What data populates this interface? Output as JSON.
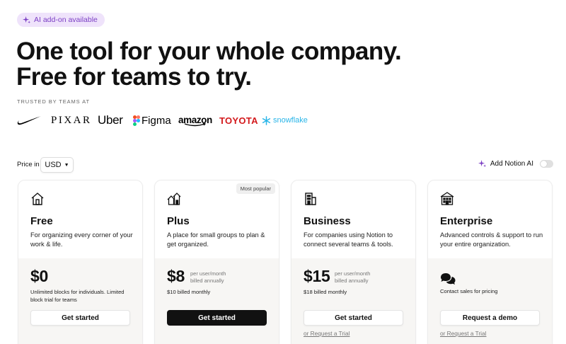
{
  "badge": {
    "label": "AI add-on available",
    "icon": "sparkle-icon",
    "color": "#7b3fc4"
  },
  "headline": {
    "line1": "One tool for your whole company.",
    "line2": "Free for teams to try."
  },
  "trusted": {
    "label": "TRUSTED BY TEAMS AT"
  },
  "logos": {
    "nike": "nike-swoosh-logo",
    "pixar": "PIXAR",
    "uber": "Uber",
    "figma": "Figma",
    "amazon": "amazon",
    "toyota": "TOYOTA",
    "snowflake": "snowflake"
  },
  "pricing_controls": {
    "price_in_label": "Price in",
    "currency_value": "USD",
    "ai_toggle_label": "Add Notion AI",
    "ai_toggle_on": false
  },
  "plans": [
    {
      "name": "Free",
      "description": "For organizing every corner of your work & life.",
      "price": "$0",
      "price_note": "",
      "billing": "Unlimited blocks for individuals. Limited block trial for teams",
      "button": "Get started",
      "trial_link": "",
      "badge": ""
    },
    {
      "name": "Plus",
      "description": "A place for small groups to plan & get organized.",
      "price": "$8",
      "price_note_1": "per user/month",
      "price_note_2": "billed annually",
      "billing": "$10 billed monthly",
      "button": "Get started",
      "trial_link": "",
      "badge": "Most popular"
    },
    {
      "name": "Business",
      "description": "For companies using Notion to connect several teams & tools.",
      "price": "$15",
      "price_note_1": "per user/month",
      "price_note_2": "billed annually",
      "billing": "$18 billed monthly",
      "button": "Get started",
      "trial_link": "or Request a Trial",
      "badge": ""
    },
    {
      "name": "Enterprise",
      "description": "Advanced controls & support to run your entire organization.",
      "price": "",
      "billing": "Contact sales for pricing",
      "button": "Request a demo",
      "trial_link": "or Request a Trial",
      "badge": ""
    }
  ],
  "colors": {
    "accent": "#7b3fc4",
    "toyota": "#d3191c",
    "snowflake": "#29b5e8",
    "dark_button": "#111111"
  }
}
